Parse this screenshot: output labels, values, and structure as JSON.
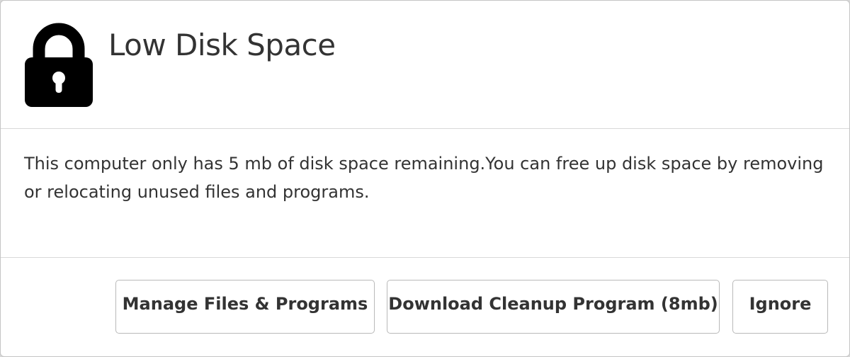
{
  "dialog": {
    "title": "Low Disk Space",
    "icon": "lock-icon",
    "message": "This computer only has 5 mb of disk space remaining.You can free up disk space by removing or relocating unused files and programs.",
    "buttons": {
      "manage": "Manage Files & Programs",
      "download": "Download Cleanup Program (8mb)",
      "ignore": "Ignore"
    }
  },
  "colors": {
    "text": "#333333",
    "divider": "#d9d9d9",
    "button_border": "#b9b9b9",
    "icon": "#000000"
  }
}
